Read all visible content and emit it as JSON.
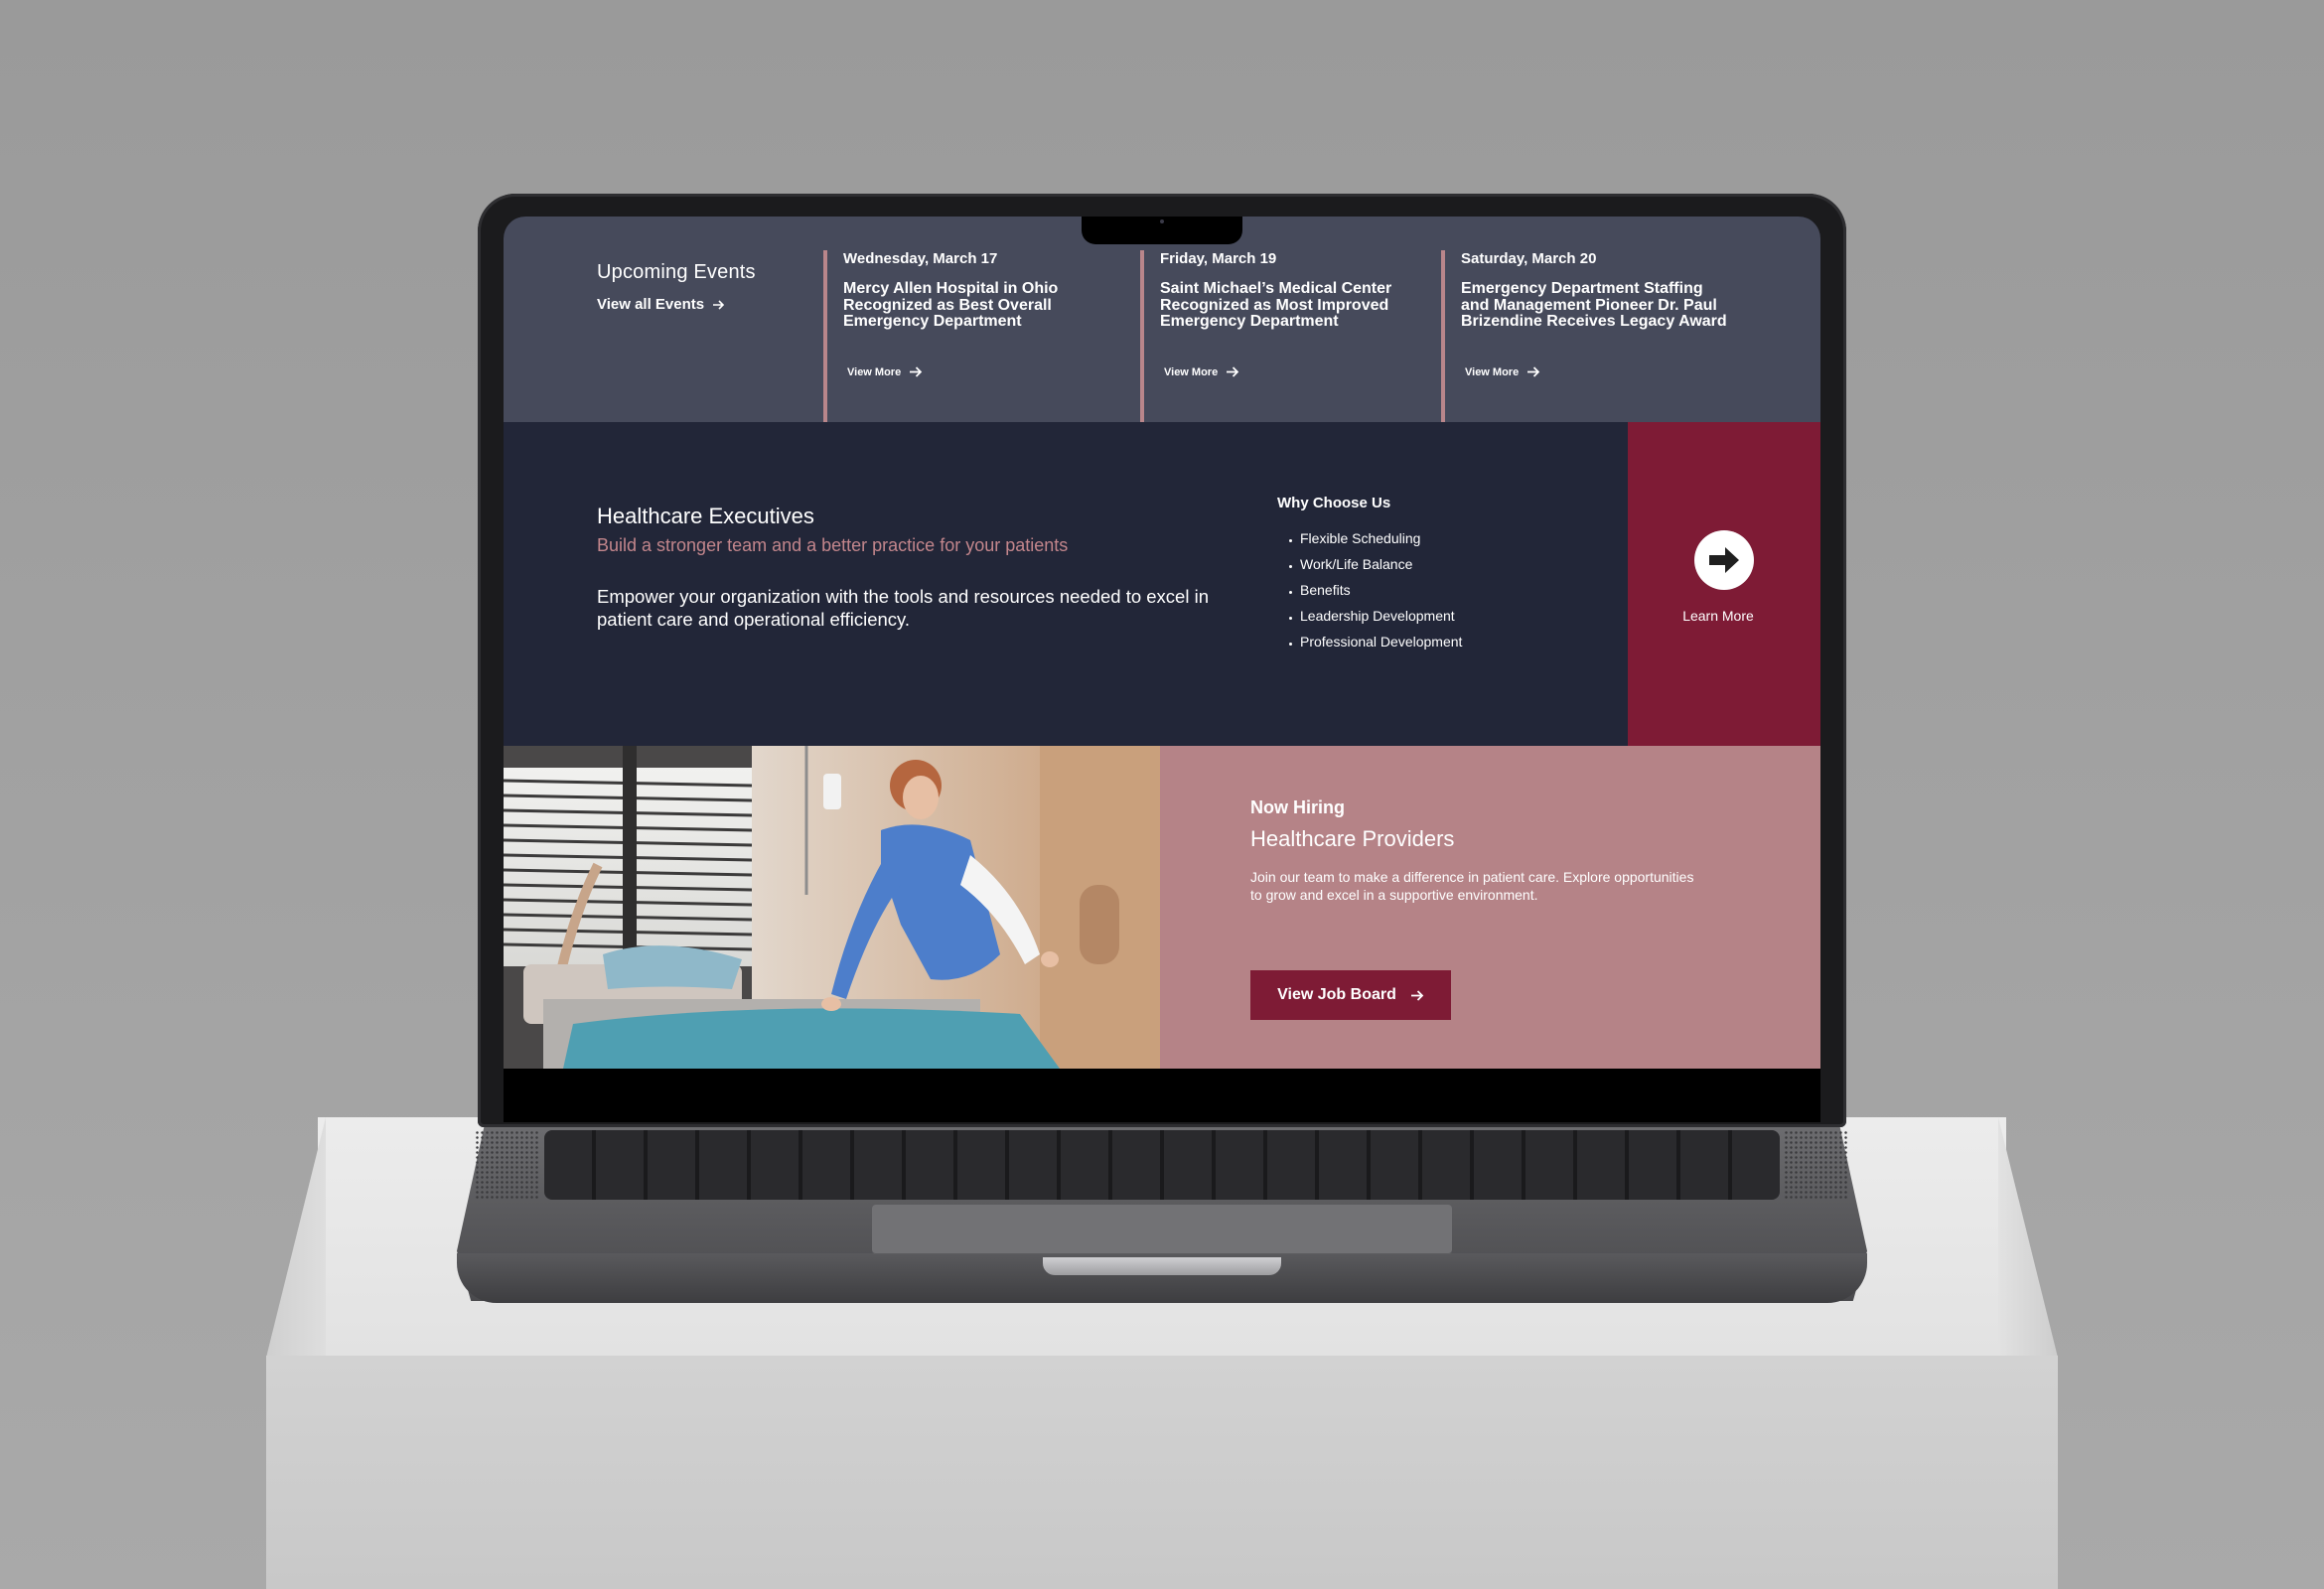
{
  "events": {
    "heading": "Upcoming Events",
    "view_all": "View all Events",
    "items": [
      {
        "date": "Wednesday, March 17",
        "title": "Mercy Allen Hospital in Ohio Recognized as Best Overall Emergency Department",
        "more": "View More"
      },
      {
        "date": "Friday, March 19",
        "title": "Saint Michael’s Medical Center Recognized as Most Improved Emergency Department",
        "more": "View More"
      },
      {
        "date": "Saturday, March 20",
        "title": "Emergency Department Staffing and Management Pioneer Dr. Paul Brizendine Receives Legacy Award",
        "more": "View More"
      }
    ]
  },
  "executives": {
    "title": "Healthcare Executives",
    "subtitle": "Build a stronger team and a better practice for your patients",
    "body": "Empower your organization with the tools and resources needed to excel in patient care and operational efficiency.",
    "why_title": "Why Choose Us",
    "why_items": [
      "Flexible Scheduling",
      "Work/Life Balance",
      "Benefits",
      "Leadership Development",
      "Professional Development"
    ],
    "cta_label": "Learn More"
  },
  "hiring": {
    "kicker": "Now Hiring",
    "title": "Healthcare Providers",
    "body": "Join our team to make a difference in patient care. Explore opportunities to grow and excel in a supportive environment.",
    "button": "View Job Board"
  },
  "colors": {
    "events_bg": "#464a5b",
    "navy": "#222638",
    "burgundy": "#7e1b35",
    "rose": "#b58387",
    "accent_pink": "#c3868c"
  },
  "icons": [
    "arrow-right-icon",
    "circle-arrow-icon"
  ]
}
